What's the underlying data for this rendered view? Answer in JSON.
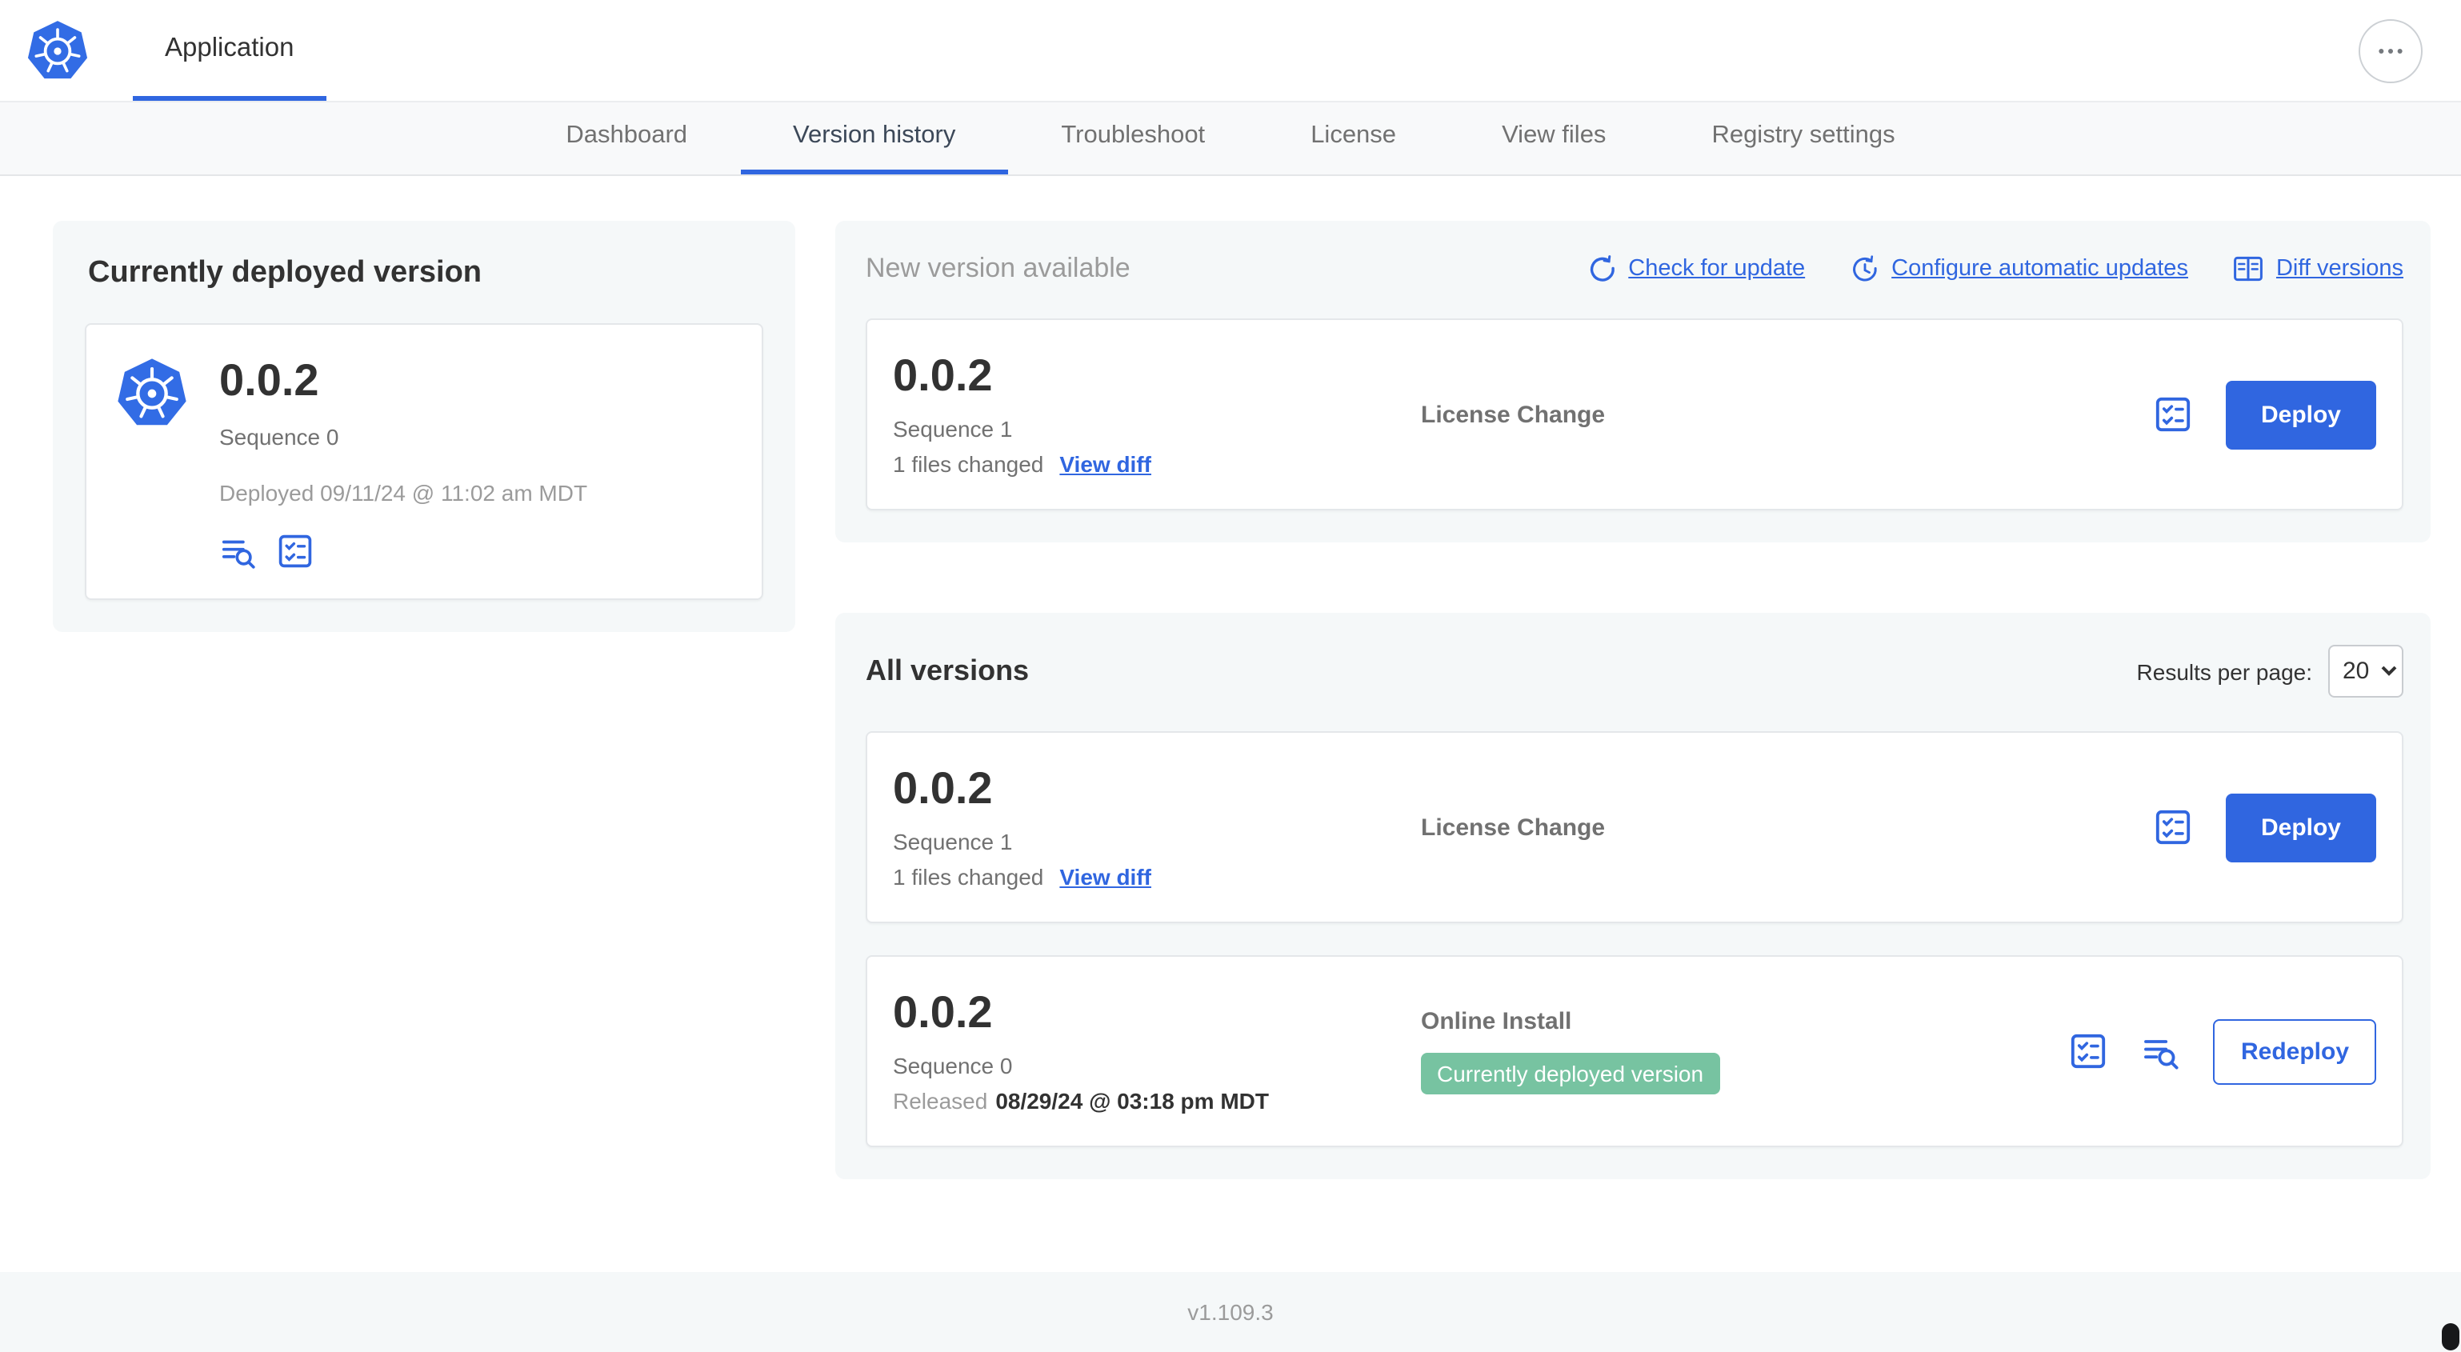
{
  "header": {
    "app_tab": "Application"
  },
  "nav": {
    "tabs": [
      {
        "label": "Dashboard"
      },
      {
        "label": "Version history"
      },
      {
        "label": "Troubleshoot"
      },
      {
        "label": "License"
      },
      {
        "label": "View files"
      },
      {
        "label": "Registry settings"
      }
    ],
    "active_tab": "Version history"
  },
  "deployed": {
    "title": "Currently deployed version",
    "version": "0.0.2",
    "sequence": "Sequence 0",
    "deployed_at": "Deployed 09/11/24 @ 11:02 am MDT"
  },
  "new_version": {
    "title": "New version available",
    "actions": {
      "check_for_update": "Check for update",
      "configure_auto_updates": "Configure automatic updates",
      "diff_versions": "Diff versions"
    },
    "card": {
      "version": "0.0.2",
      "sequence": "Sequence 1",
      "files_changed": "1 files changed",
      "view_diff": "View diff",
      "source": "License Change",
      "deploy_label": "Deploy"
    }
  },
  "all_versions": {
    "title": "All versions",
    "results_per_page_label": "Results per page:",
    "results_per_page_value": "20",
    "rows": [
      {
        "version": "0.0.2",
        "sequence": "Sequence 1",
        "files_changed": "1 files changed",
        "view_diff": "View diff",
        "source": "License Change",
        "action_label": "Deploy"
      },
      {
        "version": "0.0.2",
        "sequence": "Sequence 0",
        "released_prefix": "Released",
        "released_date": "08/29/24 @ 03:18 pm MDT",
        "source": "Online Install",
        "badge": "Currently deployed version",
        "action_label": "Redeploy"
      }
    ]
  },
  "footer": {
    "app_version": "v1.109.3"
  },
  "icons": {
    "logo": "kubernetes-wheel",
    "header_more": "ellipsis-menu",
    "check_update": "refresh-arrow",
    "auto_updates": "clock-refresh",
    "diff": "split-table",
    "release_notes": "lines-magnifier",
    "preflight": "checklist-box"
  },
  "colors": {
    "accent": "#3066e0",
    "logo_blue": "#326ce5",
    "badge_green": "#77c3a1",
    "panel_bg": "#f5f8f9"
  }
}
